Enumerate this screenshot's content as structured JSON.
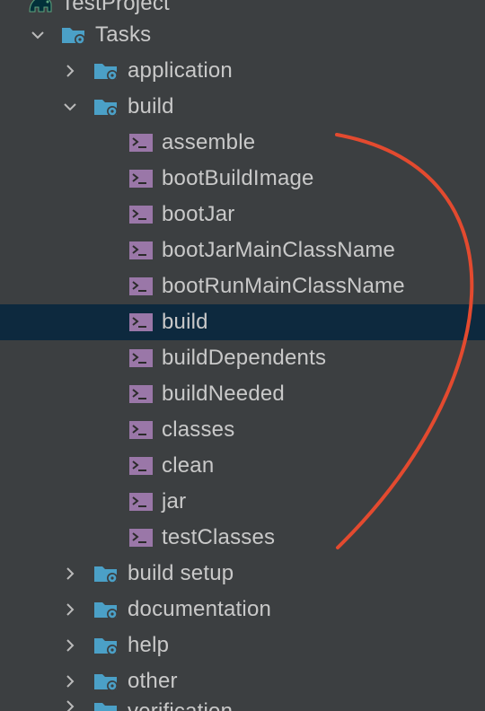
{
  "tree": {
    "root_label": "TestProject",
    "tasks_label": "Tasks",
    "groups": {
      "application": "application",
      "build": "build",
      "build_setup": "build setup",
      "documentation": "documentation",
      "help": "help",
      "other": "other",
      "verification": "verification"
    },
    "build_tasks": [
      "assemble",
      "bootBuildImage",
      "bootJar",
      "bootJarMainClassName",
      "bootRunMainClassName",
      "build",
      "buildDependents",
      "buildNeeded",
      "classes",
      "clean",
      "jar",
      "testClasses"
    ],
    "selected_task": "build"
  },
  "colors": {
    "background": "#3c3f41",
    "selection": "#0d293e",
    "folder_icon": "#4ba0c7",
    "task_icon": "#9a77a8",
    "annotation_stroke": "#e34a2f",
    "text": "#c9c9c9"
  },
  "icons": {
    "project": "gradle-elephant-icon",
    "folder": "folder-gear-icon",
    "task": "terminal-task-icon",
    "expanded": "chevron-down-icon",
    "collapsed": "chevron-right-icon"
  }
}
